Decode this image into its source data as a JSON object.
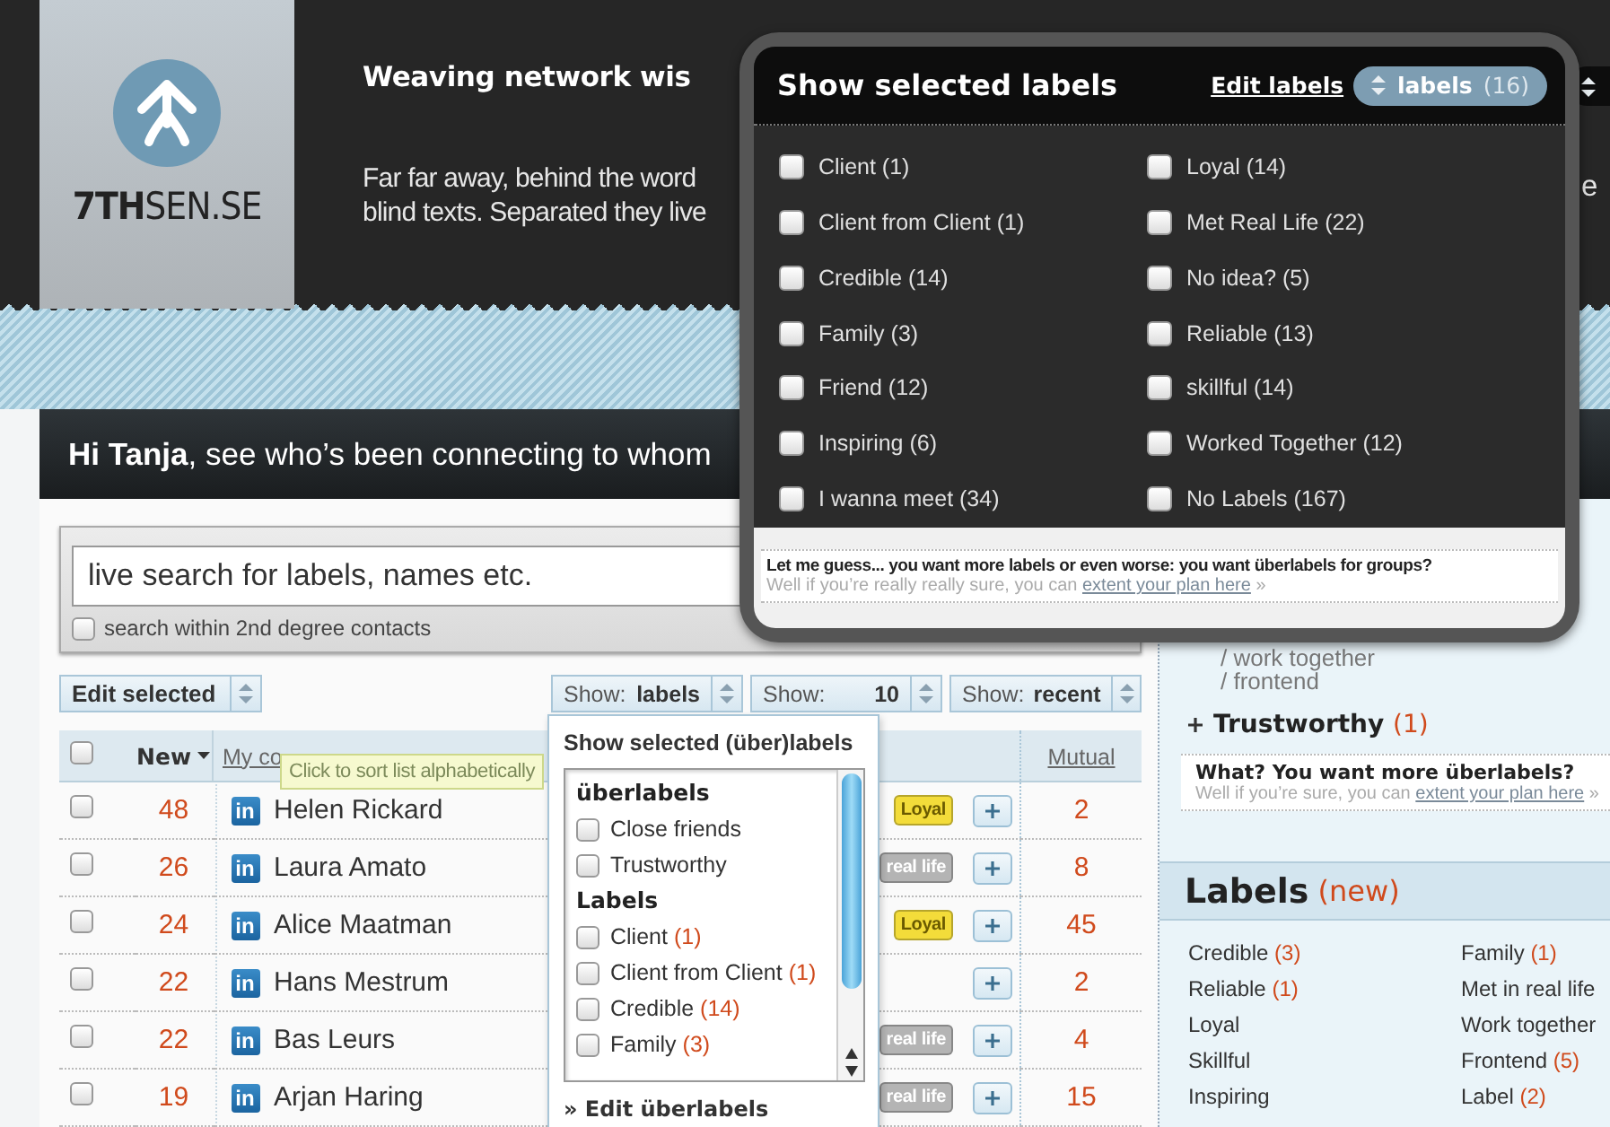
{
  "header": {
    "logo": "**7TH**SEN.SE",
    "title": "Weaving network wis",
    "intro": [
      "Far far away, behind the word",
      "blind texts. Separated they live"
    ],
    "fragment": "e"
  },
  "welcome": "**Hi Tanja**, see who’s been connecting to whom",
  "search": {
    "placeholder": "live search for labels, names etc.",
    "option": {
      "label": "search within 2nd degree contacts",
      "checked": false
    }
  },
  "toolbar": {
    "edit": "Edit selected",
    "filters": [
      {
        "label": "Show:",
        "value": "labels"
      },
      {
        "label": "Show:",
        "value": "10"
      },
      {
        "label": "Show:",
        "value": "recent"
      }
    ]
  },
  "table": {
    "select_all": {
      "checked": false
    },
    "columns": [
      {
        "label": "New",
        "kind": "sort"
      },
      {
        "label": "My co",
        "kind": "link"
      },
      {
        "label": "Mutual",
        "kind": "link"
      }
    ],
    "rows": [
      {
        "checked": false,
        "new": "48",
        "source": "in",
        "name": "Helen Rickard",
        "tags": [
          {
            "label": "Loyal",
            "color": "#f3dc3a"
          }
        ],
        "mutual": "2"
      },
      {
        "checked": false,
        "new": "26",
        "source": "in",
        "name": "Laura Amato",
        "tags": [
          {
            "label": "real life",
            "color": "#b4b4b4"
          }
        ],
        "mutual": "8"
      },
      {
        "checked": false,
        "new": "24",
        "source": "in",
        "name": "Alice Maatman",
        "tags": [
          {
            "label": "Loyal",
            "color": "#f3dc3a"
          }
        ],
        "mutual": "45"
      },
      {
        "checked": false,
        "new": "22",
        "source": "in",
        "name": "Hans Mestrum",
        "tags": [],
        "mutual": "2"
      },
      {
        "checked": false,
        "new": "22",
        "source": "in",
        "name": "Bas Leurs",
        "tags": [
          {
            "label": "real life",
            "color": "#b4b4b4"
          }
        ],
        "mutual": "4"
      },
      {
        "checked": false,
        "new": "19",
        "source": "in",
        "name": "Arjan Haring",
        "tags": [
          {
            "label": "real life",
            "color": "#b4b4b4"
          }
        ],
        "mutual": "15"
      }
    ]
  },
  "tooltip": "Click to sort list alphabetically",
  "label_popup": {
    "title": "Show selected labels",
    "edit_link": "Edit labels",
    "selector": {
      "label": "labels",
      "count": "(16)"
    },
    "items": [
      {
        "label": "Client (1)",
        "checked": false
      },
      {
        "label": "Loyal (14)",
        "checked": false
      },
      {
        "label": "Client from Client (1)",
        "checked": false
      },
      {
        "label": "Met Real Life (22)",
        "checked": false
      },
      {
        "label": "Credible (14)",
        "checked": false
      },
      {
        "label": "No idea? (5)",
        "checked": false
      },
      {
        "label": "Family (3)",
        "checked": false
      },
      {
        "label": "Reliable (13)",
        "checked": false
      },
      {
        "label": "Friend (12)",
        "checked": false
      },
      {
        "label": "skillful (14)",
        "checked": false
      },
      {
        "label": "Inspiring (6)",
        "checked": false
      },
      {
        "label": "Worked Together (12)",
        "checked": false
      },
      {
        "label": "I wanna meet (34)",
        "checked": false
      },
      {
        "label": "No Labels (167)",
        "checked": false
      }
    ],
    "upsell": {
      "headline": "Let me guess... you want more labels or even worse: you want überlabels for groups?",
      "text": "Well if you’re really really sure, you can",
      "link": "extent your plan here",
      "suffix": "»"
    }
  },
  "filter_dropdown": {
    "title": "Show selected (über)labels",
    "groups": [
      {
        "heading": "überlabels",
        "items": [
          {
            "label": "Close friends",
            "checked": false
          },
          {
            "label": "Trustworthy",
            "checked": false
          }
        ]
      },
      {
        "heading": "Labels",
        "items": [
          {
            "label": "Client",
            "count": "(1)",
            "checked": false
          },
          {
            "label": "Client from Client",
            "count": "(1)",
            "checked": false
          },
          {
            "label": "Credible",
            "count": "(14)",
            "checked": false
          },
          {
            "label": "Family",
            "count": "(3)",
            "checked": false
          }
        ]
      }
    ],
    "footer_link": "» Edit überlabels"
  },
  "sidebar": {
    "paths": [
      "/ work together",
      "/ frontend"
    ],
    "group": {
      "label": "Trustworthy",
      "count": "(1)"
    },
    "upsell": {
      "headline": "What? You want more überlabels?",
      "text": "Well if you’re sure, you can",
      "link": "extent your plan here",
      "suffix": "»"
    },
    "labels_title": "Labels",
    "labels_badge": "(new)",
    "labels": [
      {
        "label": "Credible",
        "count": "(3)"
      },
      {
        "label": "Family",
        "count": "(1)"
      },
      {
        "label": "Reliable",
        "count": "(1)"
      },
      {
        "label": "Met in real life"
      },
      {
        "label": "Loyal"
      },
      {
        "label": "Work together"
      },
      {
        "label": "Skillful"
      },
      {
        "label": "Frontend",
        "count": "(5)"
      },
      {
        "label": "Inspiring"
      },
      {
        "label": "Label",
        "count": "(2)"
      }
    ]
  }
}
